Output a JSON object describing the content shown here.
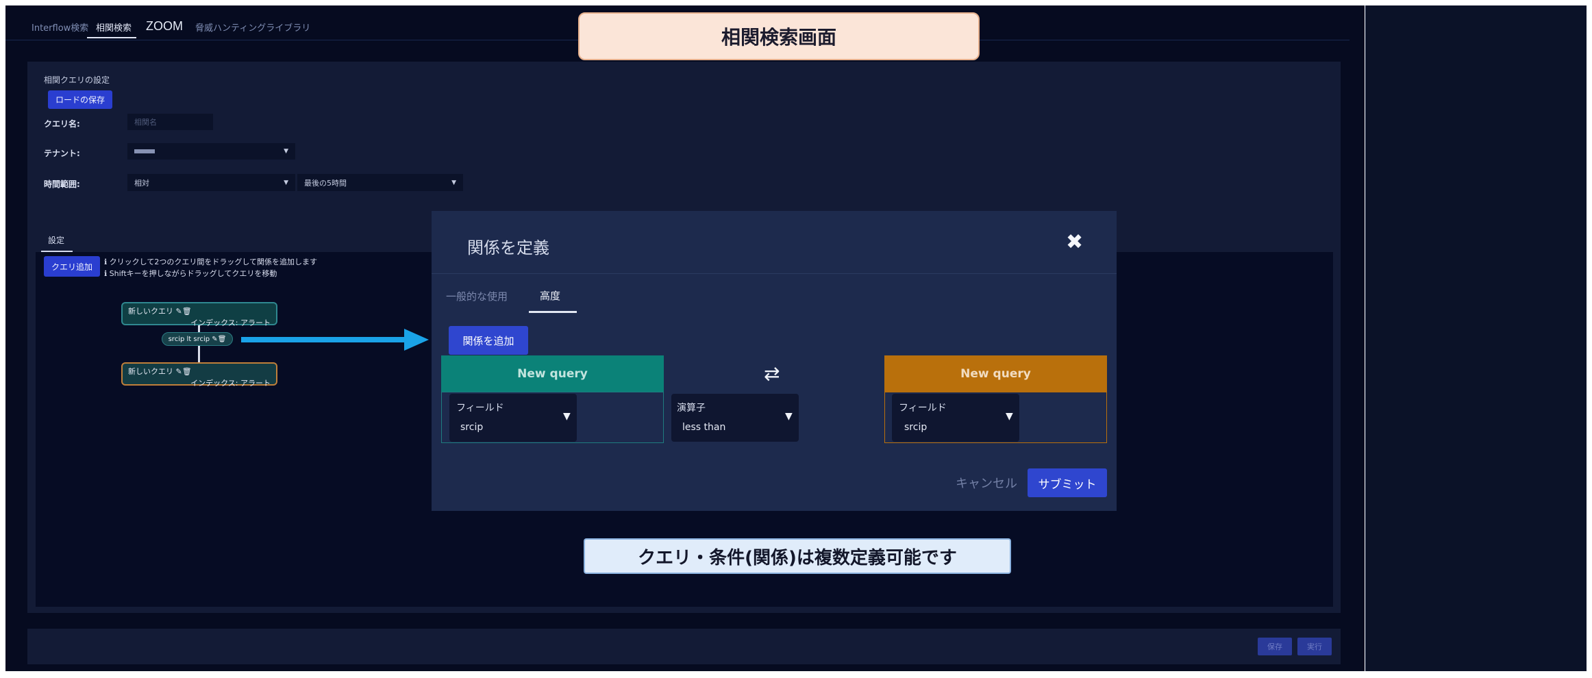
{
  "top_tabs": {
    "interflow": "Interflow検索",
    "correlation": "相関検索",
    "zoom": "ZOOM",
    "threat_library": "脅威ハンティングライブラリ"
  },
  "callouts": {
    "title": "相関検索画面",
    "note": "クエリ・条件(関係)は複数定義可能です"
  },
  "config": {
    "section_title": "相関クエリの設定",
    "load_save_button": "ロードの保存",
    "query_name_label": "クエリ名:",
    "query_name_placeholder": "相関名",
    "tenant_label": "テナント:",
    "tenant_value": "",
    "time_range_label": "時間範囲:",
    "time_range_type": "相対",
    "time_range_value": "最後の5時間"
  },
  "settings": {
    "tab_label": "設定",
    "add_query_button": "クエリ追加",
    "hint_1": "ℹ クリックして2つのクエリ間をドラッグして関係を追加します",
    "hint_2": "ℹ Shiftキーを押しながらドラッグしてクエリを移動",
    "node_1_title": "新しいクエリ",
    "node_1_index": "インデックス: アラート",
    "relation_chip": "srcip lt srcip",
    "node_2_title": "新しいクエリ",
    "node_2_index": "インデックス: アラート"
  },
  "bottom": {
    "save": "保存",
    "run": "実行"
  },
  "modal": {
    "title": "関係を定義",
    "close": "✖",
    "tab_general": "一般的な使用",
    "tab_advanced": "高度",
    "add_relation_button": "関係を追加",
    "left_query": {
      "header": "New query",
      "field_label": "フィールド",
      "field_value": "srcip"
    },
    "swap_symbol": "⇄",
    "operator": {
      "label": "演算子",
      "value": "less than"
    },
    "right_query": {
      "header": "New query",
      "field_label": "フィールド",
      "field_value": "srcip"
    },
    "cancel": "キャンセル",
    "submit": "サブミット"
  },
  "icons": {
    "edit": "edit-icon",
    "delete": "trash-icon",
    "caret": "chevron-down-icon",
    "arrow": "arrow-right-icon"
  },
  "colors": {
    "teal_header": "#0b8278",
    "orange_header": "#b9700c",
    "accent_button": "#2f46cf",
    "annotation_arrow": "#1aa3e8"
  }
}
